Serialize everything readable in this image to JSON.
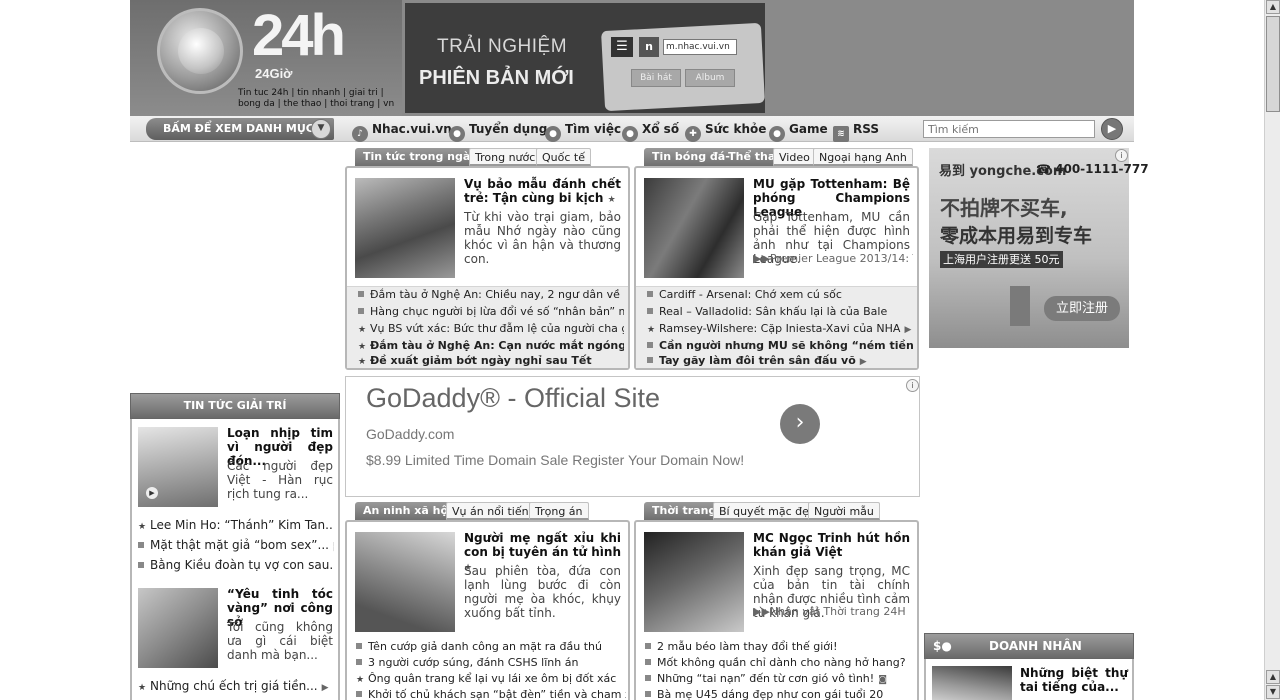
{
  "header": {
    "logo_number": "24h",
    "logo_sub": "24Giờ",
    "tagline": "Tin tuc 24h | tin nhanh | giai tri | bong da | the thao | thoi trang | vn",
    "banner": {
      "line1": "TRẢI NGHIỆM",
      "line2": "PHIÊN BẢN MỚI",
      "menu_glyph": "☰",
      "n_glyph": "n",
      "url": "m.nhac.vui.vn",
      "tab1": "Bài hát",
      "tab2": "Album"
    }
  },
  "nav": {
    "menu_label": "BẤM ĐỂ XEM DANH MỤC",
    "items": [
      {
        "label": "Nhac.vui.vn",
        "icon": "music-icon"
      },
      {
        "label": "Tuyển dụng",
        "icon": "people-icon"
      },
      {
        "label": "Tìm việc",
        "icon": "person-icon"
      },
      {
        "label": "Xổ số",
        "icon": "lottery-icon"
      },
      {
        "label": "Sức khỏe",
        "icon": "health-icon"
      },
      {
        "label": "Game",
        "icon": "game-icon"
      },
      {
        "label": "RSS",
        "icon": "rss-icon"
      }
    ],
    "search_placeholder": "Tìm kiếm"
  },
  "news_box": {
    "tabs": [
      "Tin tức trong ngày",
      "Trong nước",
      "Quốc tế"
    ],
    "headline": "Vụ bảo mẫu đánh chết trẻ: Tận cùng bi kịch",
    "summary": "Từ khi vào trại giam, bảo mẫu Nhớ ngày nào cũng khóc vì ân hận và thương con.",
    "links": [
      "Đắm tàu ở Nghệ An: Chiều nay, 2 ngư dân về bờ",
      "Hàng chục người bị lừa đổi vé số “nhân bản” màu",
      "Vụ BS vứt xác: Bức thư đẫm lệ của người cha già",
      "Đắm tàu ở Nghệ An: Cạn nước mắt ngóng chờ",
      "Đề xuất giảm bớt ngày nghỉ sau Tết"
    ]
  },
  "sport_box": {
    "tabs": [
      "Tin bóng đá-Thể thao",
      "Video",
      "Ngoại hạng Anh"
    ],
    "headline": "MU gặp Tottenham: Bệ phóng Champions League",
    "summary": "Gặp Tottenham, MU cần phải thể hiện được hình ảnh như tại Champions League.",
    "source": "Premier League 2013/14: Tứ...",
    "links": [
      "Cardiff - Arsenal: Chớ xem cú sốc",
      "Real – Valladolid: Sân khấu lại là của Bale",
      "Ramsey-Wilshere: Cặp Iniesta-Xavi của NHA",
      "Cần người nhưng MU sẽ không “ném tiền”",
      "Tay gãy làm đôi trên sân đấu võ"
    ]
  },
  "ad": {
    "title": "GoDaddy® - Official Site",
    "domain": "GoDaddy.com",
    "desc": "$8.99 Limited Time Domain Sale Register Your Domain Now!",
    "arrow": "›",
    "info": "i"
  },
  "security_box": {
    "tabs": [
      "An ninh xã hội",
      "Vụ án nổi tiếng",
      "Trọng án"
    ],
    "headline": "Người mẹ ngất xỉu khi con bị tuyên án tử hình",
    "summary": "Sau phiên tòa, đứa con lạnh lùng bước đi còn người mẹ òa khóc, khụy xuống bất tỉnh.",
    "links": [
      "Tên cướp giả danh công an mặt ra đầu thú",
      "3 người cướp súng, đánh CSHS lĩnh án",
      "Ông quân trang kể lại vụ lái xe ôm bị đốt xác",
      "Khởi tố chủ khách sạn “bật đèn” tiền và cham xe"
    ]
  },
  "fashion_box": {
    "tabs": [
      "Thời trang",
      "Bí quyết mặc đẹp",
      "Người mẫu"
    ],
    "headline": "MC Ngọc Trinh hút hồn khán giả Việt",
    "summary": "Xinh đẹp sang trọng, MC của bản tin tài chính nhận được nhiều tình cảm từ khán giả.",
    "source": "Nhân vật Thời trang 24H",
    "links": [
      "2 mẫu béo làm thay đổi thế giới!",
      "Mốt không quần chỉ dành cho nàng hở hang?",
      "Những “tai nạn” đến từ cơn gió vô tình!",
      "Bà mẹ U45 dáng đẹp như con gái tuổi 20"
    ]
  },
  "sidebar": {
    "title": "TIN TỨC GIẢI TRÍ",
    "story1": {
      "headline": "Loạn nhịp tim vì người đẹp đón...",
      "summary": "Các người đẹp Việt - Hàn rục rịch tung ra..."
    },
    "links1": [
      "Lee Min Ho: “Thánh” Kim Tan...",
      "Mặt thật mặt giả “bom sex”...",
      "Bằng Kiều đoàn tụ vợ con sau..."
    ],
    "story2": {
      "headline": "“Yêu tinh tóc vàng” nơi công sở",
      "summary": "Tôi cũng không ưa gì cái biệt danh mà bạn..."
    },
    "links2": [
      "Những chú ếch trị giá tiền..."
    ]
  },
  "right_ad": {
    "logo": "易到 yongche.com",
    "phone": "400-1111-777",
    "line1": "不拍牌不买车,",
    "line2": "零成本用易到专车",
    "tag": "上海用户注册更送 50元",
    "button": "立即注册"
  },
  "business": {
    "title": "DOANH NHÂN",
    "headline": "Những biệt thự tai tiếng của..."
  }
}
